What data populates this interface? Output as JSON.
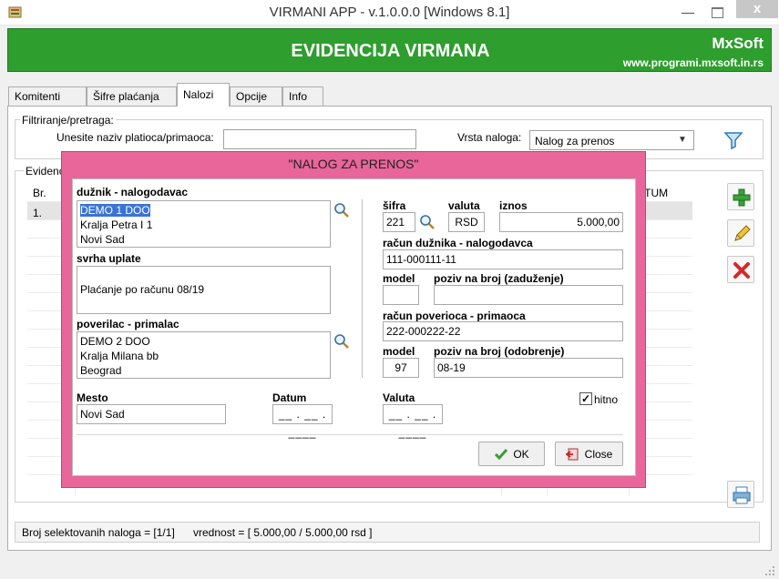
{
  "window": {
    "title": "VIRMANI APP - v.1.0.0.0  [Windows 8.1]",
    "minimize_label": "—",
    "close_label": "x"
  },
  "banner": {
    "title": "EVIDENCIJA VIRMANA",
    "brand": "MxSoft",
    "url": "www.programi.mxsoft.in.rs",
    "color": "#2e9e2e"
  },
  "tabs": [
    {
      "label": "Komitenti",
      "active": false
    },
    {
      "label": "Šifre plaćanja",
      "active": false
    },
    {
      "label": "Nalozi",
      "active": true
    },
    {
      "label": "Opcije",
      "active": false
    },
    {
      "label": "Info",
      "active": false
    }
  ],
  "filter": {
    "legend": "Filtriranje/pretraga:",
    "name_label": "Unesite naziv platioca/primaoca:",
    "name_value": "",
    "type_label": "Vrsta naloga:",
    "type_value": "Nalog za prenos",
    "filter_icon": "funnel-icon"
  },
  "evidence": {
    "legend": "Evidenc",
    "col_br": "Br.",
    "col_datum": "ATUM",
    "rows": [
      {
        "br": "1."
      }
    ]
  },
  "status": {
    "count": "Broj selektovanih naloga = [1/1]",
    "value": "vrednost = [ 5.000,00 / 5.000,00 rsd ]"
  },
  "dialog": {
    "title": "\"NALOG ZA PRENOS\"",
    "color": "#e8669a",
    "duznik_label": "dužnik - nalogodavac",
    "duznik_lines": [
      "DEMO 1 DOO",
      "Kralja Petra I 1",
      "Novi Sad"
    ],
    "svrha_label": "svrha uplate",
    "svrha_value": "Plaćanje po računu 08/19",
    "poverilac_label": "poverilac - primalac",
    "poverilac_lines": [
      "DEMO 2 DOO",
      "Kralja Milana bb",
      "Beograd"
    ],
    "sifra_label": "šifra",
    "sifra_value": "221",
    "valuta_label": "valuta",
    "valuta_value": "RSD",
    "iznos_label": "iznos",
    "iznos_value": "5.000,00",
    "racun_duznika_label": "račun dužnika - nalogodavca",
    "racun_duznika_value": "111-000111-11",
    "model1_label": "model",
    "model1_value": "",
    "poziv1_label": "poziv na broj (zaduženje)",
    "poziv1_value": "",
    "racun_poverioca_label": "račun poverioca - primaoca",
    "racun_poverioca_value": "222-000222-22",
    "model2_label": "model",
    "model2_value": "97",
    "poziv2_label": "poziv na broj (odobrenje)",
    "poziv2_value": "08-19",
    "mesto_label": "Mesto",
    "mesto_value": "Novi Sad",
    "datum_label": "Datum",
    "datum_value": "__ . __ . ____",
    "valuta_datum_label": "Valuta",
    "valuta_datum_value": "__ . __ . ____",
    "hitno_label": "hitno",
    "hitno_checked": true,
    "ok_label": "OK",
    "close_label": "Close"
  }
}
